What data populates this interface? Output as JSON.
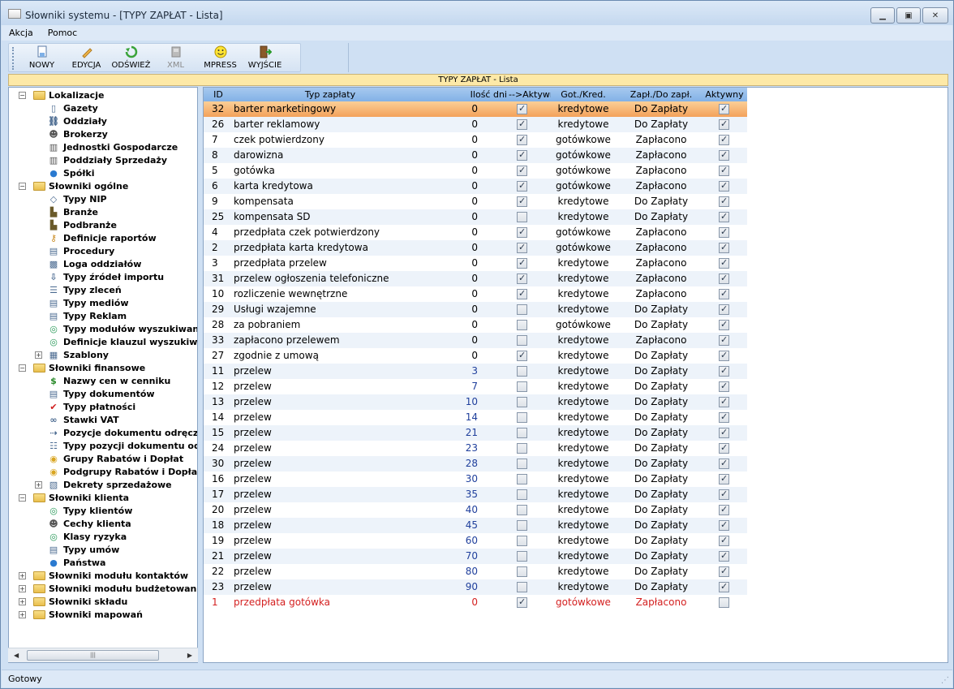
{
  "window": {
    "title": "Słowniki systemu - [TYPY ZAPŁAT - Lista]"
  },
  "menu": [
    "Akcja",
    "Pomoc"
  ],
  "toolbar": {
    "buttons": [
      {
        "label": "NOWY",
        "icon": "new-document-icon",
        "enabled": true
      },
      {
        "label": "EDYCJA",
        "icon": "pencil-icon",
        "enabled": true
      },
      {
        "label": "ODŚWIEŻ",
        "icon": "refresh-icon",
        "enabled": true
      },
      {
        "label": "XML",
        "icon": "xml-icon",
        "enabled": false
      },
      {
        "label": "MPRESS",
        "icon": "smiley-icon",
        "enabled": true
      },
      {
        "label": "WYJŚCIE",
        "icon": "exit-door-icon",
        "enabled": true
      }
    ]
  },
  "caption": "TYPY ZAPŁAT - Lista",
  "tree": [
    {
      "label": "Lokalizacje",
      "level": 0,
      "type": "folder",
      "exp": "−",
      "icon": "folder-icon"
    },
    {
      "label": "Gazety",
      "level": 1,
      "icon": "newspaper-icon"
    },
    {
      "label": "Oddziały",
      "level": 1,
      "icon": "branch-icon"
    },
    {
      "label": "Brokerzy",
      "level": 1,
      "icon": "person-icon"
    },
    {
      "label": "Jednostki Gospodarcze",
      "level": 1,
      "icon": "building-icon"
    },
    {
      "label": "Poddziały Sprzedaży",
      "level": 1,
      "icon": "building-icon"
    },
    {
      "label": "Spółki",
      "level": 1,
      "icon": "globe-icon"
    },
    {
      "label": "Słowniki ogólne",
      "level": 0,
      "type": "folder",
      "exp": "−",
      "icon": "folder-icon"
    },
    {
      "label": "Typy NIP",
      "level": 1,
      "icon": "tag-icon"
    },
    {
      "label": "Branże",
      "level": 1,
      "icon": "factory-icon"
    },
    {
      "label": "Podbranże",
      "level": 1,
      "icon": "factory-icon"
    },
    {
      "label": "Definicje raportów",
      "level": 1,
      "icon": "key-icon"
    },
    {
      "label": "Procedury",
      "level": 1,
      "icon": "procedure-icon"
    },
    {
      "label": "Loga oddziałów",
      "level": 1,
      "icon": "image-icon"
    },
    {
      "label": "Typy źródeł importu",
      "level": 1,
      "icon": "import-icon"
    },
    {
      "label": "Typy zleceń",
      "level": 1,
      "icon": "list-icon"
    },
    {
      "label": "Typy mediów",
      "level": 1,
      "icon": "document-icon"
    },
    {
      "label": "Typy Reklam",
      "level": 1,
      "icon": "document-icon"
    },
    {
      "label": "Typy modułów wyszukiwania",
      "level": 1,
      "icon": "search-icon"
    },
    {
      "label": "Definicje klauzul wyszukiwania",
      "level": 1,
      "icon": "search-icon"
    },
    {
      "label": "Szablony",
      "level": 1,
      "type": "folder",
      "exp": "+",
      "icon": "template-icon"
    },
    {
      "label": "Słowniki finansowe",
      "level": 0,
      "type": "folder",
      "exp": "−",
      "icon": "folder-icon"
    },
    {
      "label": "Nazwy cen w cenniku",
      "level": 1,
      "icon": "dollar-icon"
    },
    {
      "label": "Typy dokumentów",
      "level": 1,
      "icon": "document-icon"
    },
    {
      "label": "Typy płatności",
      "level": 1,
      "icon": "check-dollar-icon"
    },
    {
      "label": "Stawki VAT",
      "level": 1,
      "icon": "glasses-icon"
    },
    {
      "label": "Pozycje dokumentu odręcznego",
      "level": 1,
      "icon": "document-arrow-icon"
    },
    {
      "label": "Typy pozycji dokumentu odręcznego",
      "level": 1,
      "icon": "document-list-icon"
    },
    {
      "label": "Grupy Rabatów i Dopłat",
      "level": 1,
      "icon": "coins-icon"
    },
    {
      "label": "Podgrupy Rabatów i Dopłat",
      "level": 1,
      "icon": "coins-icon"
    },
    {
      "label": "Dekrety sprzedażowe",
      "level": 1,
      "type": "folder",
      "exp": "+",
      "icon": "decree-icon"
    },
    {
      "label": "Słowniki klienta",
      "level": 0,
      "type": "folder",
      "exp": "−",
      "icon": "folder-icon"
    },
    {
      "label": "Typy klientów",
      "level": 1,
      "icon": "search-icon"
    },
    {
      "label": "Cechy klienta",
      "level": 1,
      "icon": "person-icon"
    },
    {
      "label": "Klasy ryzyka",
      "level": 1,
      "icon": "search-icon"
    },
    {
      "label": "Typy umów",
      "level": 1,
      "icon": "document-icon"
    },
    {
      "label": "Państwa",
      "level": 1,
      "icon": "globe-icon"
    },
    {
      "label": "Słowniki modułu kontaktów",
      "level": 0,
      "type": "folder",
      "exp": "+",
      "icon": "folder-icon"
    },
    {
      "label": "Słowniki modułu budżetowania",
      "level": 0,
      "type": "folder",
      "exp": "+",
      "icon": "folder-icon"
    },
    {
      "label": "Słowniki składu",
      "level": 0,
      "type": "folder",
      "exp": "+",
      "icon": "folder-icon"
    },
    {
      "label": "Słowniki mapowań",
      "level": 0,
      "type": "folder",
      "exp": "+",
      "icon": "folder-icon"
    }
  ],
  "grid": {
    "columns": [
      "ID",
      "Typ zapłaty",
      "Ilość dni",
      "-->Aktywny",
      "Got./Kred.",
      "Zapł./Do zapł.",
      "Aktywny"
    ],
    "selected_row": 0,
    "rows": [
      {
        "id": "32",
        "name": "barter marketingowy",
        "days": "0",
        "active1": true,
        "gk": "kredytowe",
        "zdz": "Do Zapłaty",
        "active2": true
      },
      {
        "id": "26",
        "name": "barter reklamowy",
        "days": "0",
        "active1": true,
        "gk": "kredytowe",
        "zdz": "Do Zapłaty",
        "active2": true
      },
      {
        "id": "7",
        "name": "czek potwierdzony",
        "days": "0",
        "active1": true,
        "gk": "gotówkowe",
        "zdz": "Zapłacono",
        "active2": true
      },
      {
        "id": "8",
        "name": "darowizna",
        "days": "0",
        "active1": true,
        "gk": "gotówkowe",
        "zdz": "Zapłacono",
        "active2": true
      },
      {
        "id": "5",
        "name": "gotówka",
        "days": "0",
        "active1": true,
        "gk": "gotówkowe",
        "zdz": "Zapłacono",
        "active2": true
      },
      {
        "id": "6",
        "name": "karta kredytowa",
        "days": "0",
        "active1": true,
        "gk": "gotówkowe",
        "zdz": "Zapłacono",
        "active2": true
      },
      {
        "id": "9",
        "name": "kompensata",
        "days": "0",
        "active1": true,
        "gk": "kredytowe",
        "zdz": "Do Zapłaty",
        "active2": true
      },
      {
        "id": "25",
        "name": "kompensata SD",
        "days": "0",
        "active1": false,
        "gk": "kredytowe",
        "zdz": "Do Zapłaty",
        "active2": true
      },
      {
        "id": "4",
        "name": "przedpłata czek potwierdzony",
        "days": "0",
        "active1": true,
        "gk": "gotówkowe",
        "zdz": "Zapłacono",
        "active2": true
      },
      {
        "id": "2",
        "name": "przedpłata karta kredytowa",
        "days": "0",
        "active1": true,
        "gk": "gotówkowe",
        "zdz": "Zapłacono",
        "active2": true
      },
      {
        "id": "3",
        "name": "przedpłata przelew",
        "days": "0",
        "active1": true,
        "gk": "kredytowe",
        "zdz": "Zapłacono",
        "active2": true
      },
      {
        "id": "31",
        "name": "przelew ogłoszenia telefoniczne",
        "days": "0",
        "active1": true,
        "gk": "kredytowe",
        "zdz": "Zapłacono",
        "active2": true
      },
      {
        "id": "10",
        "name": "rozliczenie wewnętrzne",
        "days": "0",
        "active1": true,
        "gk": "kredytowe",
        "zdz": "Zapłacono",
        "active2": true
      },
      {
        "id": "29",
        "name": "Usługi wzajemne",
        "days": "0",
        "active1": false,
        "gk": "kredytowe",
        "zdz": "Do Zapłaty",
        "active2": true
      },
      {
        "id": "28",
        "name": "za pobraniem",
        "days": "0",
        "active1": false,
        "gk": "gotówkowe",
        "zdz": "Do Zapłaty",
        "active2": true
      },
      {
        "id": "33",
        "name": "zapłacono przelewem",
        "days": "0",
        "active1": false,
        "gk": "kredytowe",
        "zdz": "Zapłacono",
        "active2": true
      },
      {
        "id": "27",
        "name": "zgodnie z umową",
        "days": "0",
        "active1": true,
        "gk": "kredytowe",
        "zdz": "Do Zapłaty",
        "active2": true
      },
      {
        "id": "11",
        "name": "przelew",
        "days": "3",
        "active1": false,
        "gk": "kredytowe",
        "zdz": "Do Zapłaty",
        "active2": true
      },
      {
        "id": "12",
        "name": "przelew",
        "days": "7",
        "active1": false,
        "gk": "kredytowe",
        "zdz": "Do Zapłaty",
        "active2": true
      },
      {
        "id": "13",
        "name": "przelew",
        "days": "10",
        "active1": false,
        "gk": "kredytowe",
        "zdz": "Do Zapłaty",
        "active2": true
      },
      {
        "id": "14",
        "name": "przelew",
        "days": "14",
        "active1": false,
        "gk": "kredytowe",
        "zdz": "Do Zapłaty",
        "active2": true
      },
      {
        "id": "15",
        "name": "przelew",
        "days": "21",
        "active1": false,
        "gk": "kredytowe",
        "zdz": "Do Zapłaty",
        "active2": true
      },
      {
        "id": "24",
        "name": "przelew",
        "days": "23",
        "active1": false,
        "gk": "kredytowe",
        "zdz": "Do Zapłaty",
        "active2": true
      },
      {
        "id": "30",
        "name": "przelew",
        "days": "28",
        "active1": false,
        "gk": "kredytowe",
        "zdz": "Do Zapłaty",
        "active2": true
      },
      {
        "id": "16",
        "name": "przelew",
        "days": "30",
        "active1": false,
        "gk": "kredytowe",
        "zdz": "Do Zapłaty",
        "active2": true
      },
      {
        "id": "17",
        "name": "przelew",
        "days": "35",
        "active1": false,
        "gk": "kredytowe",
        "zdz": "Do Zapłaty",
        "active2": true
      },
      {
        "id": "20",
        "name": "przelew",
        "days": "40",
        "active1": false,
        "gk": "kredytowe",
        "zdz": "Do Zapłaty",
        "active2": true
      },
      {
        "id": "18",
        "name": "przelew",
        "days": "45",
        "active1": false,
        "gk": "kredytowe",
        "zdz": "Do Zapłaty",
        "active2": true
      },
      {
        "id": "19",
        "name": "przelew",
        "days": "60",
        "active1": false,
        "gk": "kredytowe",
        "zdz": "Do Zapłaty",
        "active2": true
      },
      {
        "id": "21",
        "name": "przelew",
        "days": "70",
        "active1": false,
        "gk": "kredytowe",
        "zdz": "Do Zapłaty",
        "active2": true
      },
      {
        "id": "22",
        "name": "przelew",
        "days": "80",
        "active1": false,
        "gk": "kredytowe",
        "zdz": "Do Zapłaty",
        "active2": true
      },
      {
        "id": "23",
        "name": "przelew",
        "days": "90",
        "active1": false,
        "gk": "kredytowe",
        "zdz": "Do Zapłaty",
        "active2": true
      },
      {
        "id": "1",
        "name": "przedpłata gotówka",
        "days": "0",
        "active1": true,
        "gk": "gotówkowe",
        "zdz": "Zapłacono",
        "active2": false,
        "red": true
      }
    ]
  },
  "status": "Gotowy",
  "colors": {
    "selected_row": "#f3a15a",
    "inactive_row_text": "#d42020",
    "header": "#82b1e6",
    "caption_bar": "#fde9a7"
  }
}
